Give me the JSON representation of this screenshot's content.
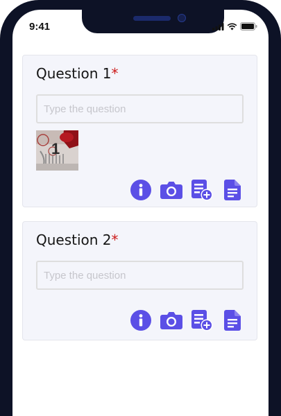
{
  "status_bar": {
    "time": "9:41",
    "icons": [
      "signal-icon",
      "wifi-icon",
      "battery-icon"
    ]
  },
  "accent_color": "#5b4fe6",
  "required_color": "#cc1b1b",
  "questions": [
    {
      "title": "Question 1",
      "required_mark": "*",
      "input": {
        "placeholder": "Type the question",
        "value": ""
      },
      "thumbnail": {
        "label": "1"
      },
      "actions": [
        "info-icon",
        "camera-icon",
        "add-list-icon",
        "document-icon"
      ]
    },
    {
      "title": "Question 2",
      "required_mark": "*",
      "input": {
        "placeholder": "Type the question",
        "value": ""
      },
      "actions": [
        "info-icon",
        "camera-icon",
        "add-list-icon",
        "document-icon"
      ]
    }
  ]
}
